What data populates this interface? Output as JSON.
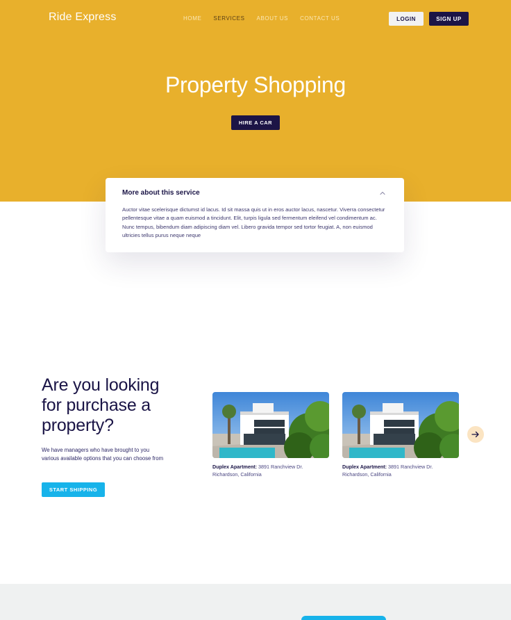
{
  "header": {
    "logo": "Ride Express",
    "nav": [
      "HOME",
      "SERVICES",
      "ABOUT US",
      "CONTACT US"
    ],
    "active_nav": "SERVICES",
    "login_label": "LOGIN",
    "signup_label": "SIGN UP"
  },
  "hero": {
    "title": "Property Shopping",
    "cta_label": "HIRE A CAR"
  },
  "service_card": {
    "title": "More about this service",
    "body": "Auctor vitae scelerisque dictumst id lacus. Id sit massa quis ut in eros auctor lacus, nascetur. Viverra consectetur pellentesque vitae a quam euismod a tincidunt. Elit, turpis ligula sed fermentum eleifend vel condimentum ac. Nunc tempus, bibendum diam adipiscing diam vel. Libero gravida tempor sed tortor feugiat. A, non euismod ultricies tellus purus neque neque"
  },
  "property_section": {
    "title": "Are you looking for purchase a property?",
    "description": "We have managers who have brought to you various available options that you can choose from",
    "cta_label": "START SHIPPING",
    "listings": [
      {
        "name": "Duplex Apartment:",
        "address": " 3891 Ranchview Dr. Richardson, California"
      },
      {
        "name": "Duplex Apartment:",
        "address": " 3891 Ranchview Dr. Richardson, California"
      }
    ],
    "next_icon": "arrow-right-icon"
  },
  "colors": {
    "hero_bg": "#e8b02c",
    "navy": "#1c1446",
    "accent_blue": "#17b3ea",
    "band_bg": "#eff1f1"
  }
}
